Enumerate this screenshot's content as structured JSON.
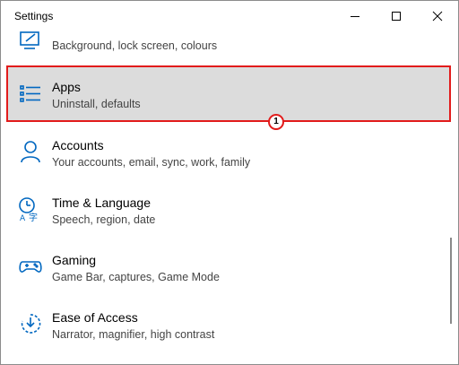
{
  "window": {
    "title": "Settings"
  },
  "colors": {
    "accent": "#0067c0",
    "highlight_border": "#e21b1b",
    "highlight_bg": "#dcdcdc"
  },
  "items": [
    {
      "icon": "personalization-icon",
      "name": "",
      "desc": "Background, lock screen, colours"
    },
    {
      "icon": "apps-icon",
      "name": "Apps",
      "desc": "Uninstall, defaults"
    },
    {
      "icon": "accounts-icon",
      "name": "Accounts",
      "desc": "Your accounts, email, sync, work, family"
    },
    {
      "icon": "time-language-icon",
      "name": "Time & Language",
      "desc": "Speech, region, date"
    },
    {
      "icon": "gaming-icon",
      "name": "Gaming",
      "desc": "Game Bar, captures, Game Mode"
    },
    {
      "icon": "ease-of-access-icon",
      "name": "Ease of Access",
      "desc": "Narrator, magnifier, high contrast"
    }
  ],
  "annotation": {
    "label": "1"
  }
}
